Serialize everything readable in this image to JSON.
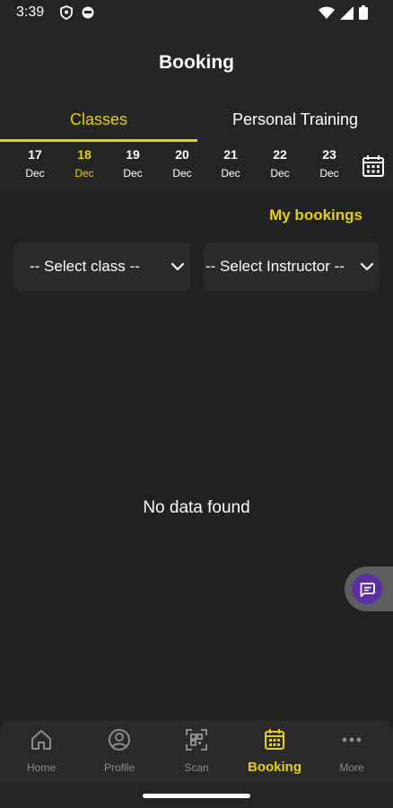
{
  "status_bar": {
    "time": "3:39"
  },
  "header": {
    "title": "Booking"
  },
  "tabs": [
    {
      "label": "Classes",
      "active": true
    },
    {
      "label": "Personal Training",
      "active": false
    }
  ],
  "dates": [
    {
      "day": "17",
      "month": "Dec",
      "selected": false
    },
    {
      "day": "18",
      "month": "Dec",
      "selected": true
    },
    {
      "day": "19",
      "month": "Dec",
      "selected": false
    },
    {
      "day": "20",
      "month": "Dec",
      "selected": false
    },
    {
      "day": "21",
      "month": "Dec",
      "selected": false
    },
    {
      "day": "22",
      "month": "Dec",
      "selected": false
    },
    {
      "day": "23",
      "month": "Dec",
      "selected": false
    }
  ],
  "my_bookings_label": "My bookings",
  "filters": {
    "class_select": "-- Select class --",
    "instructor_select": "-- Select Instructor --"
  },
  "empty_message": "No data found",
  "bottom_nav": [
    {
      "label": "Home",
      "icon": "home-icon",
      "active": false
    },
    {
      "label": "Profile",
      "icon": "profile-icon",
      "active": false
    },
    {
      "label": "Scan",
      "icon": "qr-scan-icon",
      "active": false
    },
    {
      "label": "Booking",
      "icon": "calendar-icon",
      "active": true
    },
    {
      "label": "More",
      "icon": "more-dots-icon",
      "active": false
    }
  ],
  "colors": {
    "accent": "#e6d200",
    "background": "#212121",
    "chat_button": "#5a2fa3"
  }
}
